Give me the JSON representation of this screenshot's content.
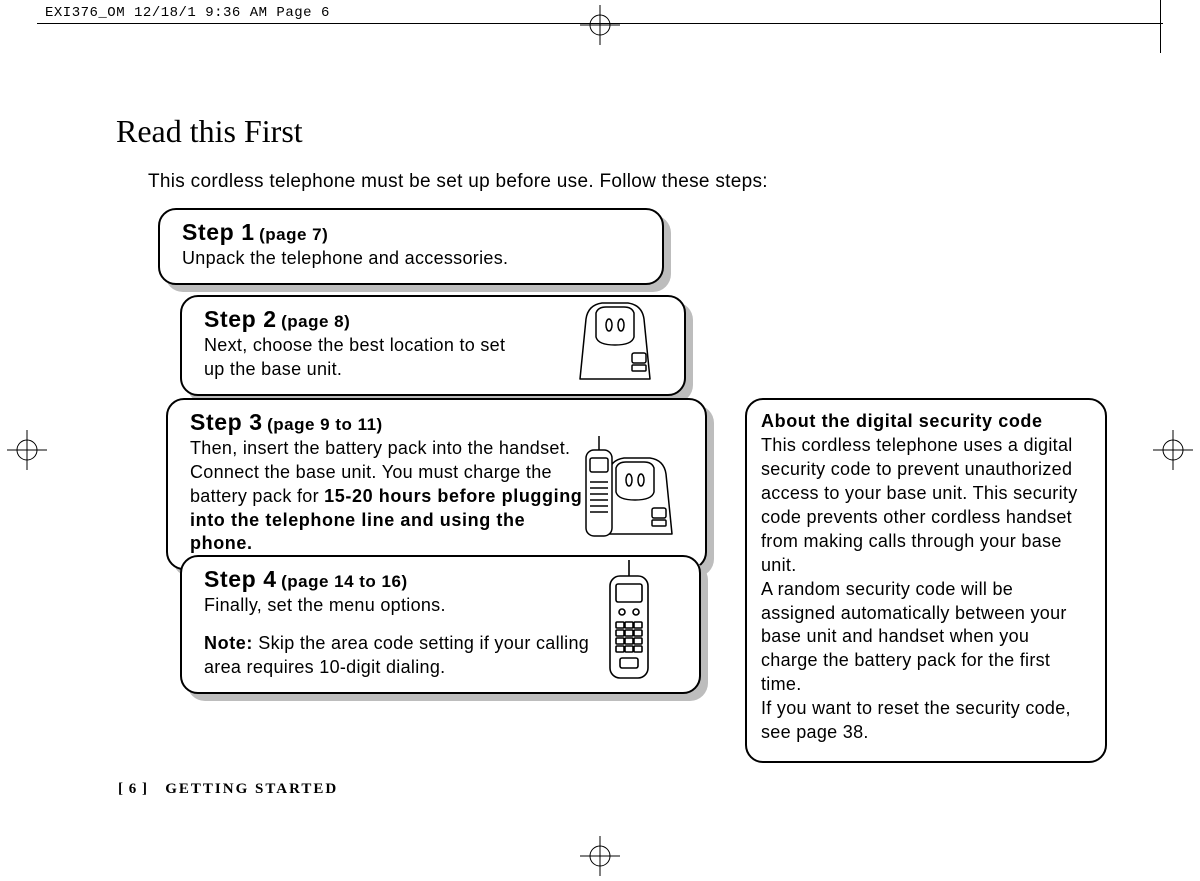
{
  "header": {
    "slug": "EXI376_OM  12/18/1 9:36 AM  Page 6"
  },
  "title": "Read this First",
  "intro": "This cordless telephone must be set up before use. Follow these steps:",
  "steps": {
    "s1": {
      "label": "Step 1",
      "page": "(page 7)",
      "body": "Unpack the telephone and accessories."
    },
    "s2": {
      "label": "Step 2",
      "page": "(page 8)",
      "body": "Next, choose the best location to set up the base unit."
    },
    "s3": {
      "label": "Step 3",
      "page": "(page 9 to 11)",
      "body_pre": "Then, insert the battery pack into the handset. Connect the base unit. You must charge the battery pack for ",
      "body_bold": "15-20 hours before plugging into the telephone line and using the phone."
    },
    "s4": {
      "label": "Step 4",
      "page": "(page 14 to 16)",
      "body1": "Finally, set the menu options.",
      "note_label": "Note:",
      "note_body": "  Skip the area code setting if your calling area requires 10-digit dialing."
    }
  },
  "about": {
    "hdr": "About the digital security code",
    "p1": "This cordless telephone uses a digital security code to prevent unauthorized access to your base unit. This security code prevents other cordless handset from making calls through your base unit.",
    "p2": "A random security code will be assigned automatically between your base unit and handset when you charge the battery pack for the first time.",
    "p3": "If you want to reset the security code, see page 38."
  },
  "footer": {
    "page": "[ 6 ]",
    "section": "GETTING STARTED"
  },
  "icons": {
    "reg": "registration-mark",
    "base": "base-unit-icon",
    "base_hand": "base-with-handset-icon",
    "hand": "handset-icon"
  }
}
